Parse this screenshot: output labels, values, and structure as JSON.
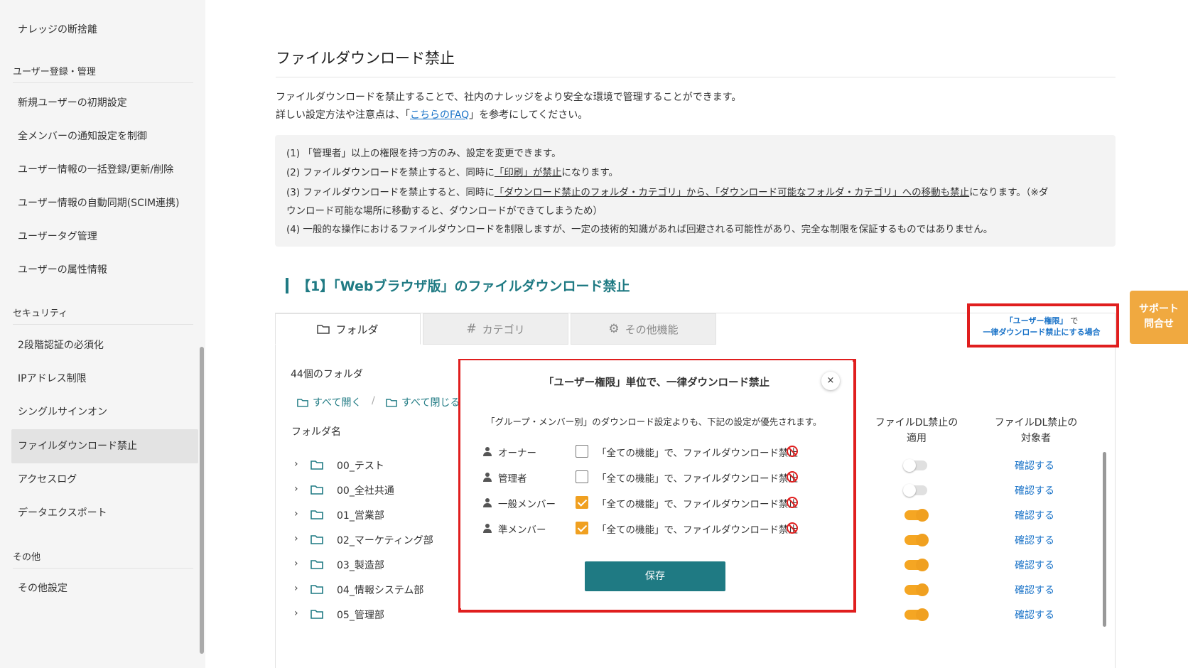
{
  "sidebar": {
    "top_item": "ナレッジの断捨離",
    "sections": [
      {
        "title": "ユーザー登録・管理",
        "items": [
          "新規ユーザーの初期設定",
          "全メンバーの通知設定を制御",
          "ユーザー情報の一括登録/更新/削除",
          "ユーザー情報の自動同期(SCIM連携)",
          "ユーザータグ管理",
          "ユーザーの属性情報"
        ]
      },
      {
        "title": "セキュリティ",
        "items": [
          "2段階認証の必須化",
          "IPアドレス制限",
          "シングルサインオン",
          "ファイルダウンロード禁止",
          "アクセスログ",
          "データエクスポート"
        ]
      },
      {
        "title": "その他",
        "items": [
          "その他設定"
        ]
      }
    ],
    "active_item": "ファイルダウンロード禁止"
  },
  "page": {
    "title": "ファイルダウンロード禁止",
    "desc_line1": "ファイルダウンロードを禁止することで、社内のナレッジをより安全な環境で管理することができます。",
    "desc_line2_pre": "詳しい設定方法や注意点は、「",
    "desc_line2_link": "こちらのFAQ",
    "desc_line2_post": "」を参考にしてください。"
  },
  "notice": {
    "line1": "(1) 「管理者」以上の権限を持つ方のみ、設定を変更できます。",
    "line2_pre": "(2) ファイルダウンロードを禁止すると、同時に",
    "line2_u": "「印刷」が禁止",
    "line2_post": "になります。",
    "line3_pre": "(3) ファイルダウンロードを禁止すると、同時に",
    "line3_u": "「ダウンロード禁止のフォルダ・カテゴリ」から、「ダウンロード可能なフォルダ・カテゴリ」への移動も禁止",
    "line3_post": "になります。（※ダ",
    "line3b": "ウンロード可能な場所に移動すると、ダウンロードができてしまうため）",
    "line4": "(4) 一般的な操作におけるファイルダウンロードを制限しますが、一定の技術的知識があれば回避される可能性があり、完全な制限を保証するものではありません。"
  },
  "section": {
    "title": "【1】「Webブラウザ版」のファイルダウンロード禁止"
  },
  "tabs": {
    "folder": "フォルダ",
    "category": "カテゴリ",
    "other": "その他機能"
  },
  "folders": {
    "count": "44個のフォルダ",
    "expand_all": "すべて開く",
    "separator": "/",
    "collapse_all": "すべて閉じる",
    "col_name": "フォルダ名",
    "col_apply_1": "ファイルDL禁止の",
    "col_apply_2": "適用",
    "col_target_1": "ファイルDL禁止の",
    "col_target_2": "対象者",
    "confirm_label": "確認する",
    "rows": [
      {
        "name": "00_テスト",
        "enabled": false
      },
      {
        "name": "00_全社共通",
        "enabled": false
      },
      {
        "name": "01_営業部",
        "enabled": true
      },
      {
        "name": "02_マーケティング部",
        "enabled": true
      },
      {
        "name": "03_製造部",
        "enabled": true
      },
      {
        "name": "04_情報システム部",
        "enabled": true
      },
      {
        "name": "05_管理部",
        "enabled": true
      }
    ]
  },
  "perm_link": {
    "line1_a": "「ユーザー権限」",
    "line1_b": "で",
    "line2": "一律ダウンロード禁止にする場合"
  },
  "support": {
    "line1": "サポート",
    "line2": "問合せ"
  },
  "modal": {
    "title": "「ユーザー権限」単位で、一律ダウンロード禁止",
    "close": "×",
    "note": "「グループ・メンバー別」のダウンロード設定よりも、下記の設定が優先されます。",
    "role_desc": "「全ての機能」で、ファイルダウンロード禁止",
    "roles": [
      {
        "name": "オーナー",
        "checked": false
      },
      {
        "name": "管理者",
        "checked": false
      },
      {
        "name": "一般メンバー",
        "checked": true
      },
      {
        "name": "準メンバー",
        "checked": true
      }
    ],
    "save": "保存"
  },
  "colors": {
    "teal": "#1f7a83",
    "orange": "#f0a020",
    "red_highlight": "#e01e1e",
    "link_blue": "#1a73c8"
  }
}
